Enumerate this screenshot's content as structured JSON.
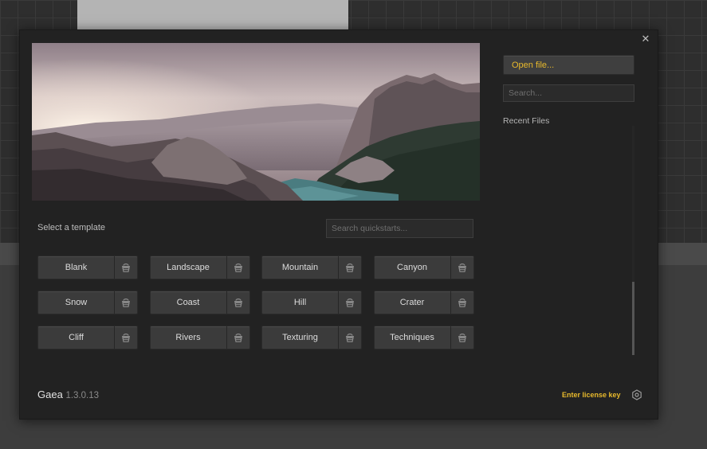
{
  "dialog": {
    "close_label": "✕"
  },
  "templates": {
    "section_label": "Select a template",
    "search_placeholder": "Search quickstarts...",
    "items": [
      {
        "label": "Blank"
      },
      {
        "label": "Landscape"
      },
      {
        "label": "Mountain"
      },
      {
        "label": "Canyon"
      },
      {
        "label": "Snow"
      },
      {
        "label": "Coast"
      },
      {
        "label": "Hill"
      },
      {
        "label": "Crater"
      },
      {
        "label": "Cliff"
      },
      {
        "label": "Rivers"
      },
      {
        "label": "Texturing"
      },
      {
        "label": "Techniques"
      }
    ],
    "item_icon": "bucket-icon"
  },
  "footer": {
    "app_name": "Gaea",
    "version": "1.3.0.13",
    "license_link": "Enter license key",
    "settings_icon": "gear-icon"
  },
  "files": {
    "open_label": "Open file...",
    "search_placeholder": "Search...",
    "recent_label": "Recent Files"
  },
  "colors": {
    "accent": "#e8b92c",
    "dialog_bg": "#222222",
    "button_bg": "#3b3b3b"
  }
}
